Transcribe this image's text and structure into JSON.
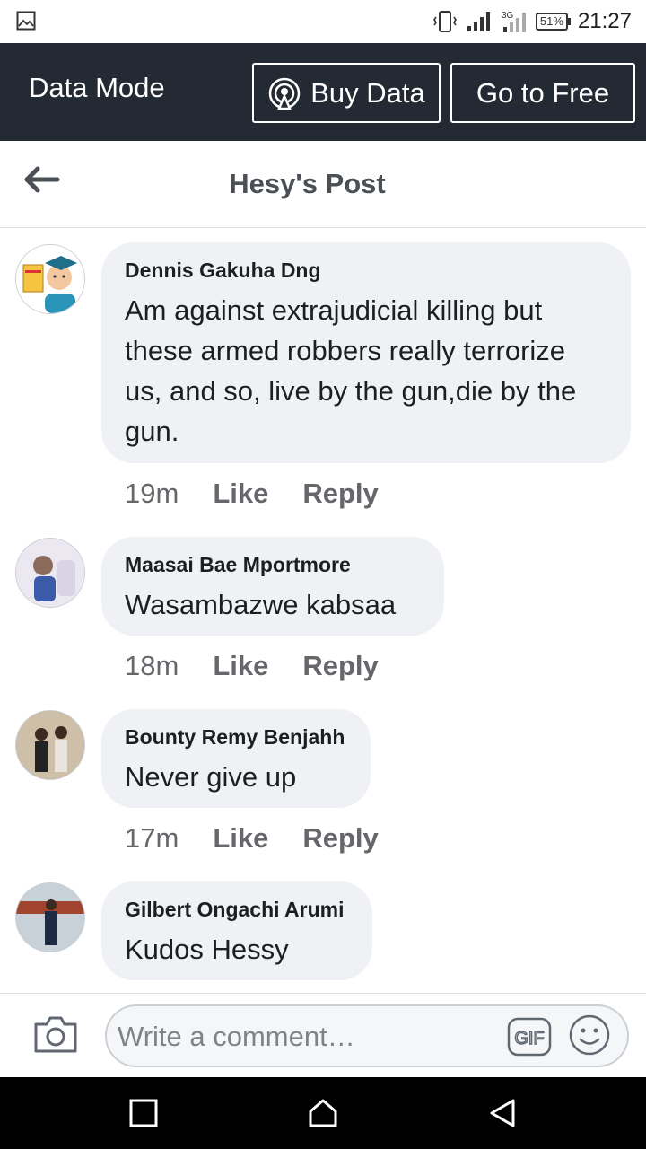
{
  "status_bar": {
    "gallery_icon": "image-icon",
    "network": "3G",
    "battery": "51%",
    "time": "21:27"
  },
  "data_mode": {
    "title": "Data Mode",
    "buy_label": "Buy Data",
    "free_label": "Go to Free"
  },
  "header": {
    "title": "Hesy's Post"
  },
  "comments": [
    {
      "author": "Dennis Gakuha Dng",
      "text": "Am against extrajudicial killing but these armed robbers really terrorize us, and so, live by the gun,die by the gun.",
      "time": "19m",
      "like": "Like",
      "reply": "Reply"
    },
    {
      "author": "Maasai Bae Mportmore",
      "text": "Wasambazwe kabsaa",
      "time": "18m",
      "like": "Like",
      "reply": "Reply"
    },
    {
      "author": "Bounty Remy Benjahh",
      "text": "Never give up",
      "time": "17m",
      "like": "Like",
      "reply": "Reply"
    },
    {
      "author": "Gilbert Ongachi Arumi",
      "text": "Kudos Hessy"
    }
  ],
  "composer": {
    "placeholder": "Write a comment…",
    "value": ""
  },
  "colors": {
    "data_bar_bg": "#242a33",
    "bubble_bg": "#f0f1f5",
    "meta_text": "#65676b"
  }
}
